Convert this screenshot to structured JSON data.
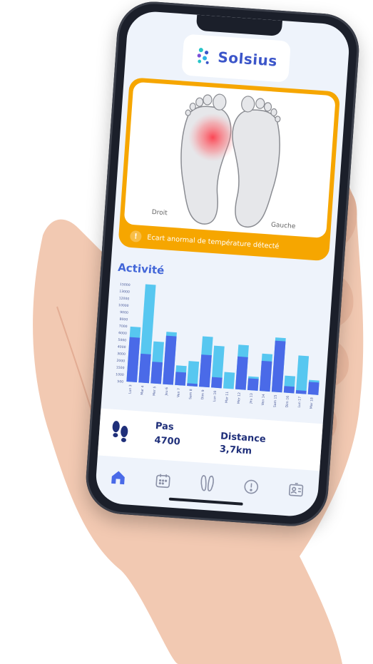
{
  "app": {
    "name": "Solsius"
  },
  "feet": {
    "right_label": "Droit",
    "left_label": "Gauche",
    "alert_text": "Ecart anormal de température détecté"
  },
  "activity": {
    "title": "Activité"
  },
  "stats": {
    "steps_label": "Pas",
    "steps_value": "4700",
    "distance_label": "Distance",
    "distance_value": "3,7km"
  },
  "nav": {
    "items": [
      "home-icon",
      "calendar-icon",
      "insoles-icon",
      "alert-icon",
      "profile-card-icon"
    ],
    "active": "home-icon"
  },
  "colors": {
    "brand": "#3b55c9",
    "alert": "#f6a600",
    "bar_dark": "#4a6ae8",
    "bar_light": "#57c7f0",
    "screen_bg": "#eef3fb"
  },
  "chart_data": {
    "type": "bar",
    "categories": [
      "Lun 3",
      "Mar 4",
      "Mer 5",
      "Jeu 6",
      "Ven 7",
      "Sam 8",
      "Dim 9",
      "Lun 10",
      "Mar 11",
      "Mer 12",
      "Jeu 13",
      "Ven 14",
      "Sam 15",
      "Dim 16",
      "Lun 17",
      "Mar 18"
    ],
    "series": [
      {
        "values": [
          6800,
          4400,
          3300,
          7400,
          2000,
          400,
          4900,
          1600,
          0,
          5000,
          1800,
          4600,
          7800,
          1000,
          500,
          1900
        ]
      },
      {
        "values": [
          8400,
          15000,
          6400,
          8000,
          3000,
          3800,
          7700,
          6400,
          2500,
          6800,
          2100,
          5700,
          8300,
          2600,
          5800,
          2200
        ]
      }
    ],
    "yticks": [
      "15000",
      "13000",
      "12000",
      "10000",
      "9000",
      "8000",
      "7000",
      "6000",
      "5000",
      "4000",
      "3000",
      "2000",
      "1500",
      "1000",
      "500"
    ],
    "ylim": [
      0,
      15000
    ]
  }
}
